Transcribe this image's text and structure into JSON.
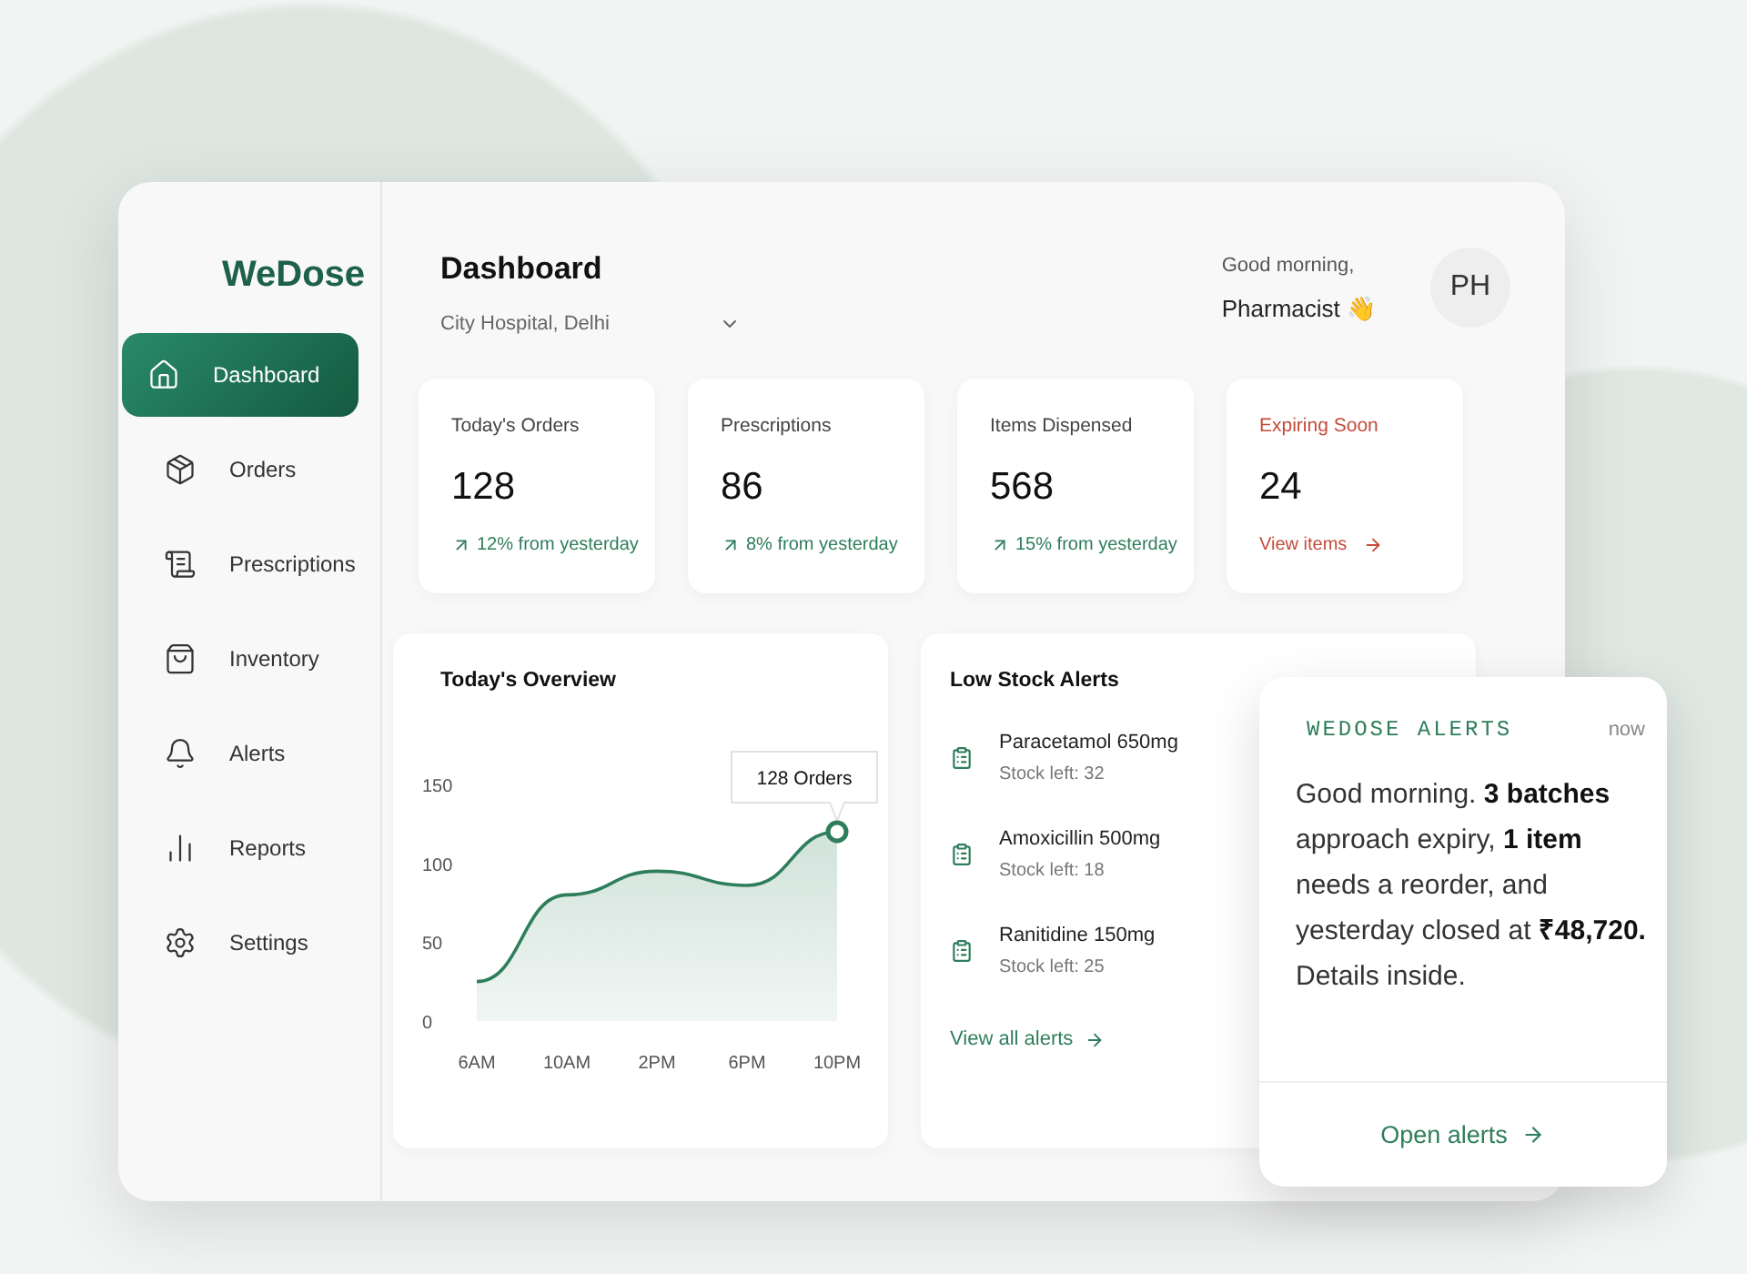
{
  "brand": "WeDose",
  "nav": [
    {
      "label": "Dashboard",
      "selected": true
    },
    {
      "label": "Orders",
      "selected": false
    },
    {
      "label": "Prescriptions",
      "selected": false
    },
    {
      "label": "Inventory",
      "selected": false
    },
    {
      "label": "Alerts",
      "selected": false
    },
    {
      "label": "Reports",
      "selected": false
    },
    {
      "label": "Settings",
      "selected": false
    }
  ],
  "header": {
    "title": "Dashboard",
    "location": "City Hospital, Delhi",
    "greeting": "Good morning,",
    "user": "Pharmacist 👋",
    "avatar": "PH"
  },
  "stats": [
    {
      "label": "Today's Orders",
      "value": "128",
      "note": "12% from yesterday",
      "kind": "trend"
    },
    {
      "label": "Prescriptions",
      "value": "86",
      "note": "8% from yesterday",
      "kind": "trend"
    },
    {
      "label": "Items Dispensed",
      "value": "568",
      "note": "15% from yesterday",
      "kind": "trend"
    },
    {
      "label": "Expiring Soon",
      "value": "24",
      "note": "View items",
      "kind": "warning"
    }
  ],
  "overview": {
    "title": "Today's Overview",
    "chart_data": {
      "type": "area",
      "categories": [
        "6AM",
        "10AM",
        "2PM",
        "6PM",
        "10PM"
      ],
      "series": [
        {
          "color": "#2e7d5b",
          "values": [
            25,
            80,
            95,
            86,
            120
          ]
        }
      ],
      "ylim": [
        0,
        150
      ],
      "yticks": [
        0,
        50,
        100,
        150
      ],
      "annotations": [
        {
          "x": "10PM",
          "y": 120,
          "text": "128 Orders"
        }
      ]
    }
  },
  "low_stock": {
    "title": "Low Stock Alerts",
    "items": [
      {
        "name": "Paracetamol 650mg",
        "stock": "Stock left: 32"
      },
      {
        "name": "Amoxicillin 500mg",
        "stock": "Stock left: 18"
      },
      {
        "name": "Ranitidine 150mg",
        "stock": "Stock left: 25"
      }
    ],
    "link": "View all alerts"
  },
  "notification": {
    "app": "WEDOSE ALERTS",
    "time": "now",
    "message": "Good morning. **3 batches** approach expiry, **1 item** needs a reorder, and yesterday closed at **₹48,720.**",
    "detail": "Details inside.",
    "action": "Open alerts"
  }
}
